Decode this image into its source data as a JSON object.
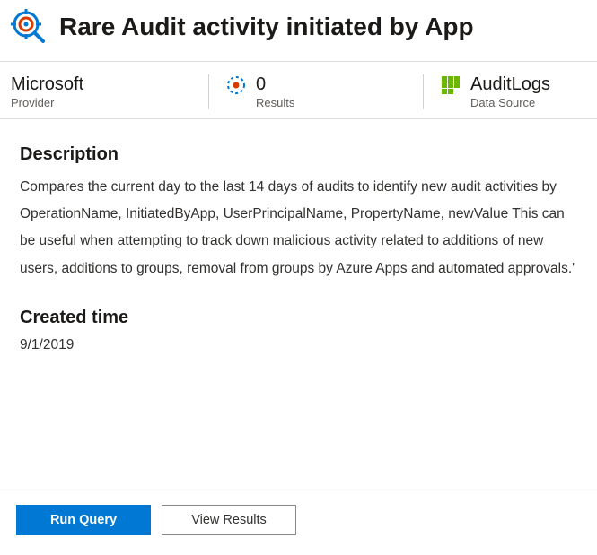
{
  "header": {
    "title": "Rare Audit activity initiated by App",
    "icon": "target-search-icon"
  },
  "meta": {
    "provider": {
      "value": "Microsoft",
      "label": "Provider"
    },
    "results": {
      "value": "0",
      "label": "Results",
      "icon": "activity-icon"
    },
    "datasource": {
      "value": "AuditLogs",
      "label": "Data Source",
      "icon": "grid-icon"
    }
  },
  "content": {
    "description_heading": "Description",
    "description_body": "Compares the current day to the last 14 days of audits to identify new audit activities by OperationName, InitiatedByApp, UserPrincipalName, PropertyName, newValue This can be useful when attempting to track down malicious activity related to additions of new users, additions to groups, removal from groups by Azure Apps and automated approvals.'",
    "created_heading": "Created time",
    "created_value": "9/1/2019"
  },
  "footer": {
    "run_label": "Run Query",
    "view_label": "View Results"
  },
  "colors": {
    "primary": "#0078d4",
    "accent_green": "#6bb700",
    "icon_blue": "#0078d4",
    "icon_orange": "#d83b01"
  }
}
